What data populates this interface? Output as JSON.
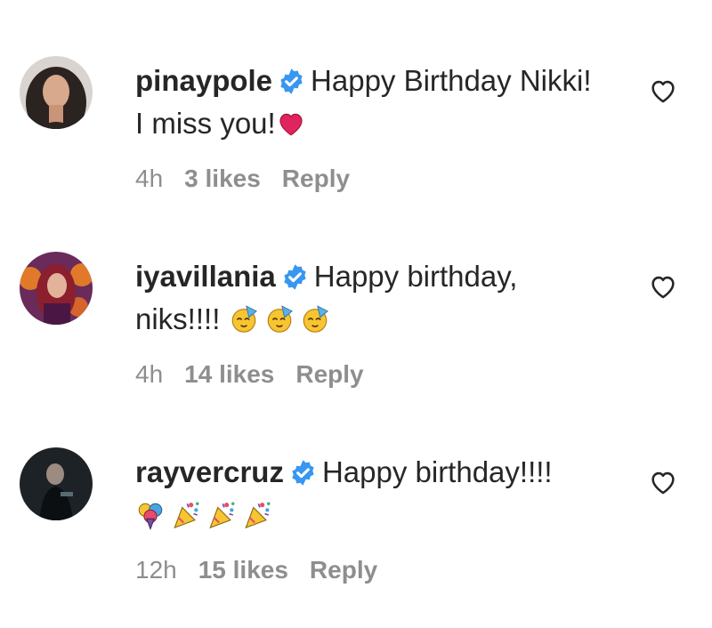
{
  "comments": [
    {
      "username": "pinaypole",
      "text": "Happy Birthday Nikki! I miss you!",
      "emojis": [
        "red-heart"
      ],
      "time": "4h",
      "likes": "3 likes",
      "reply": "Reply"
    },
    {
      "username": "iyavillania",
      "text": "Happy birthday, niks!!!!",
      "emojis": [
        "partying-face",
        "partying-face",
        "partying-face"
      ],
      "time": "4h",
      "likes": "14 likes",
      "reply": "Reply"
    },
    {
      "username": "rayvercruz",
      "text": "Happy birthday!!!!",
      "emojis": [
        "balloon-bouquet",
        "party-popper",
        "party-popper",
        "party-popper"
      ],
      "time": "12h",
      "likes": "15 likes",
      "reply": "Reply"
    }
  ],
  "icons": {
    "verified_badge": "verified-badge-icon",
    "like": "heart-outline-icon"
  },
  "colors": {
    "verified": "#3897f0",
    "username": "#262626",
    "meta": "#8e8e8e",
    "heart_emoji": "#e0245e"
  }
}
